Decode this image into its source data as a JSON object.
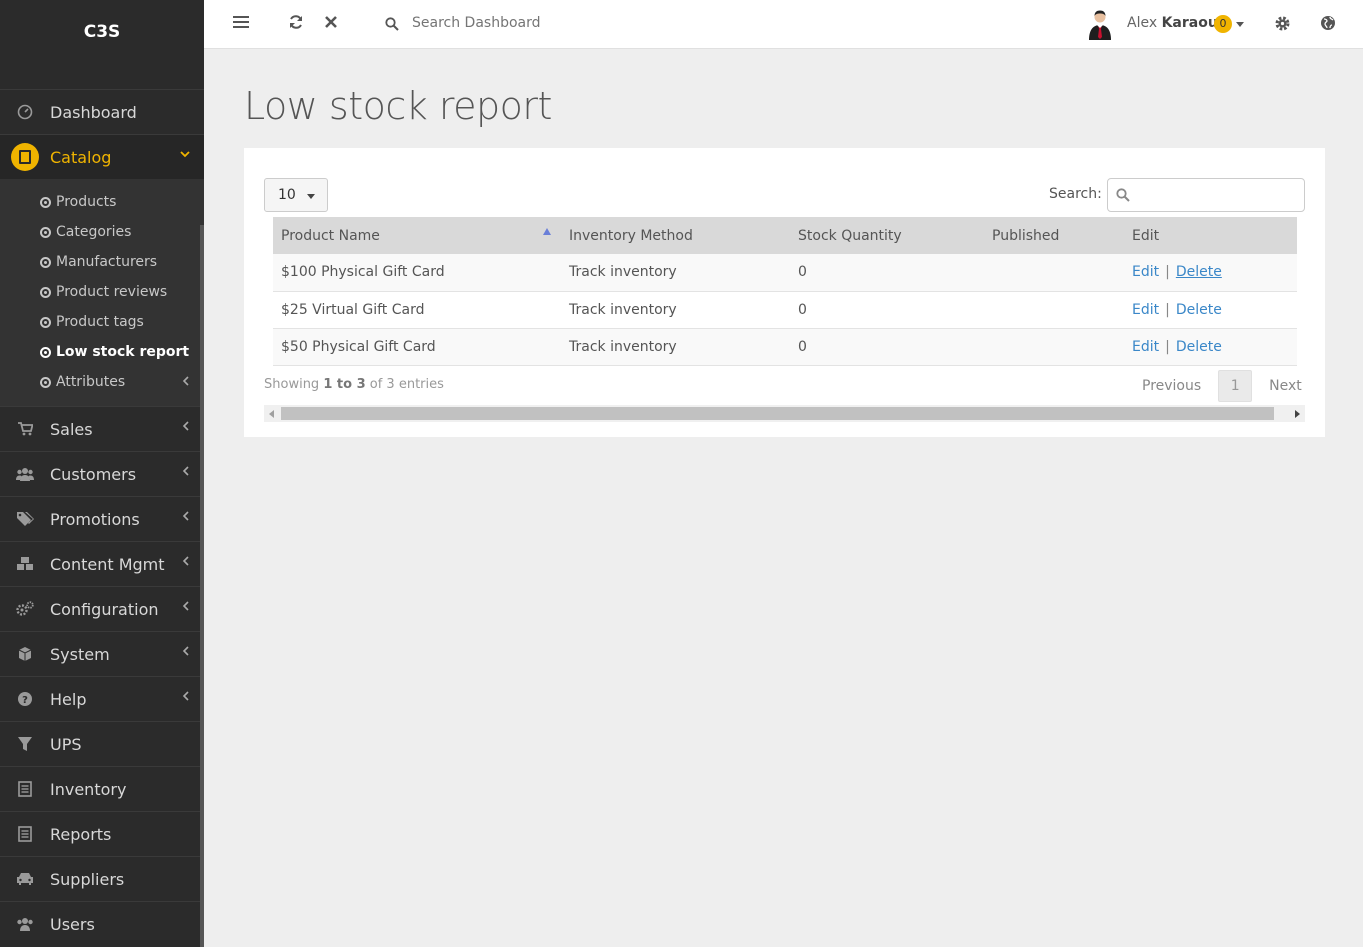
{
  "app": {
    "brand": "C3S"
  },
  "topbar": {
    "search_placeholder": "Search Dashboard",
    "user_first": "Alex",
    "user_last": "Karaoui",
    "notification_count": "0"
  },
  "sidebar": {
    "items_top": [
      {
        "label": "Dashboard",
        "icon": "dashboard-icon"
      }
    ],
    "active": {
      "label": "Catalog",
      "icon": "book-icon"
    },
    "subitems": [
      {
        "label": "Products"
      },
      {
        "label": "Categories"
      },
      {
        "label": "Manufacturers"
      },
      {
        "label": "Product reviews"
      },
      {
        "label": "Product tags"
      },
      {
        "label": "Low stock report"
      },
      {
        "label": "Attributes"
      }
    ],
    "items_bottom": [
      {
        "label": "Sales",
        "icon": "cart-icon"
      },
      {
        "label": "Customers",
        "icon": "users-icon"
      },
      {
        "label": "Promotions",
        "icon": "tags-icon"
      },
      {
        "label": "Content Mgmt",
        "icon": "cubes-icon"
      },
      {
        "label": "Configuration",
        "icon": "cogs-icon"
      },
      {
        "label": "System",
        "icon": "cube-icon"
      },
      {
        "label": "Help",
        "icon": "question-icon"
      },
      {
        "label": "UPS",
        "icon": "filter-icon"
      },
      {
        "label": "Inventory",
        "icon": "list-icon"
      },
      {
        "label": "Reports",
        "icon": "list-icon"
      },
      {
        "label": "Suppliers",
        "icon": "car-icon"
      },
      {
        "label": "Users",
        "icon": "users-icon"
      }
    ]
  },
  "main": {
    "title": "Low stock report",
    "page_length": "10",
    "search_label": "Search:",
    "columns": [
      "Product Name",
      "Inventory Method",
      "Stock Quantity",
      "Published",
      "Edit"
    ],
    "rows": [
      {
        "name": "$100 Physical Gift Card",
        "method": "Track inventory",
        "qty": "0",
        "published": "",
        "edit": "Edit",
        "delete": "Delete"
      },
      {
        "name": "$25 Virtual Gift Card",
        "method": "Track inventory",
        "qty": "0",
        "published": "",
        "edit": "Edit",
        "delete": "Delete"
      },
      {
        "name": "$50 Physical Gift Card",
        "method": "Track inventory",
        "qty": "0",
        "published": "",
        "edit": "Edit",
        "delete": "Delete"
      }
    ],
    "info_prefix": "Showing",
    "info_range": "1 to 3",
    "info_suffix": "of 3 entries",
    "pager": {
      "previous": "Previous",
      "current": "1",
      "next": "Next"
    }
  },
  "colors": {
    "accent": "#f0b400",
    "sidebar_bg": "#2b2b2b",
    "link": "#3a87c8"
  }
}
